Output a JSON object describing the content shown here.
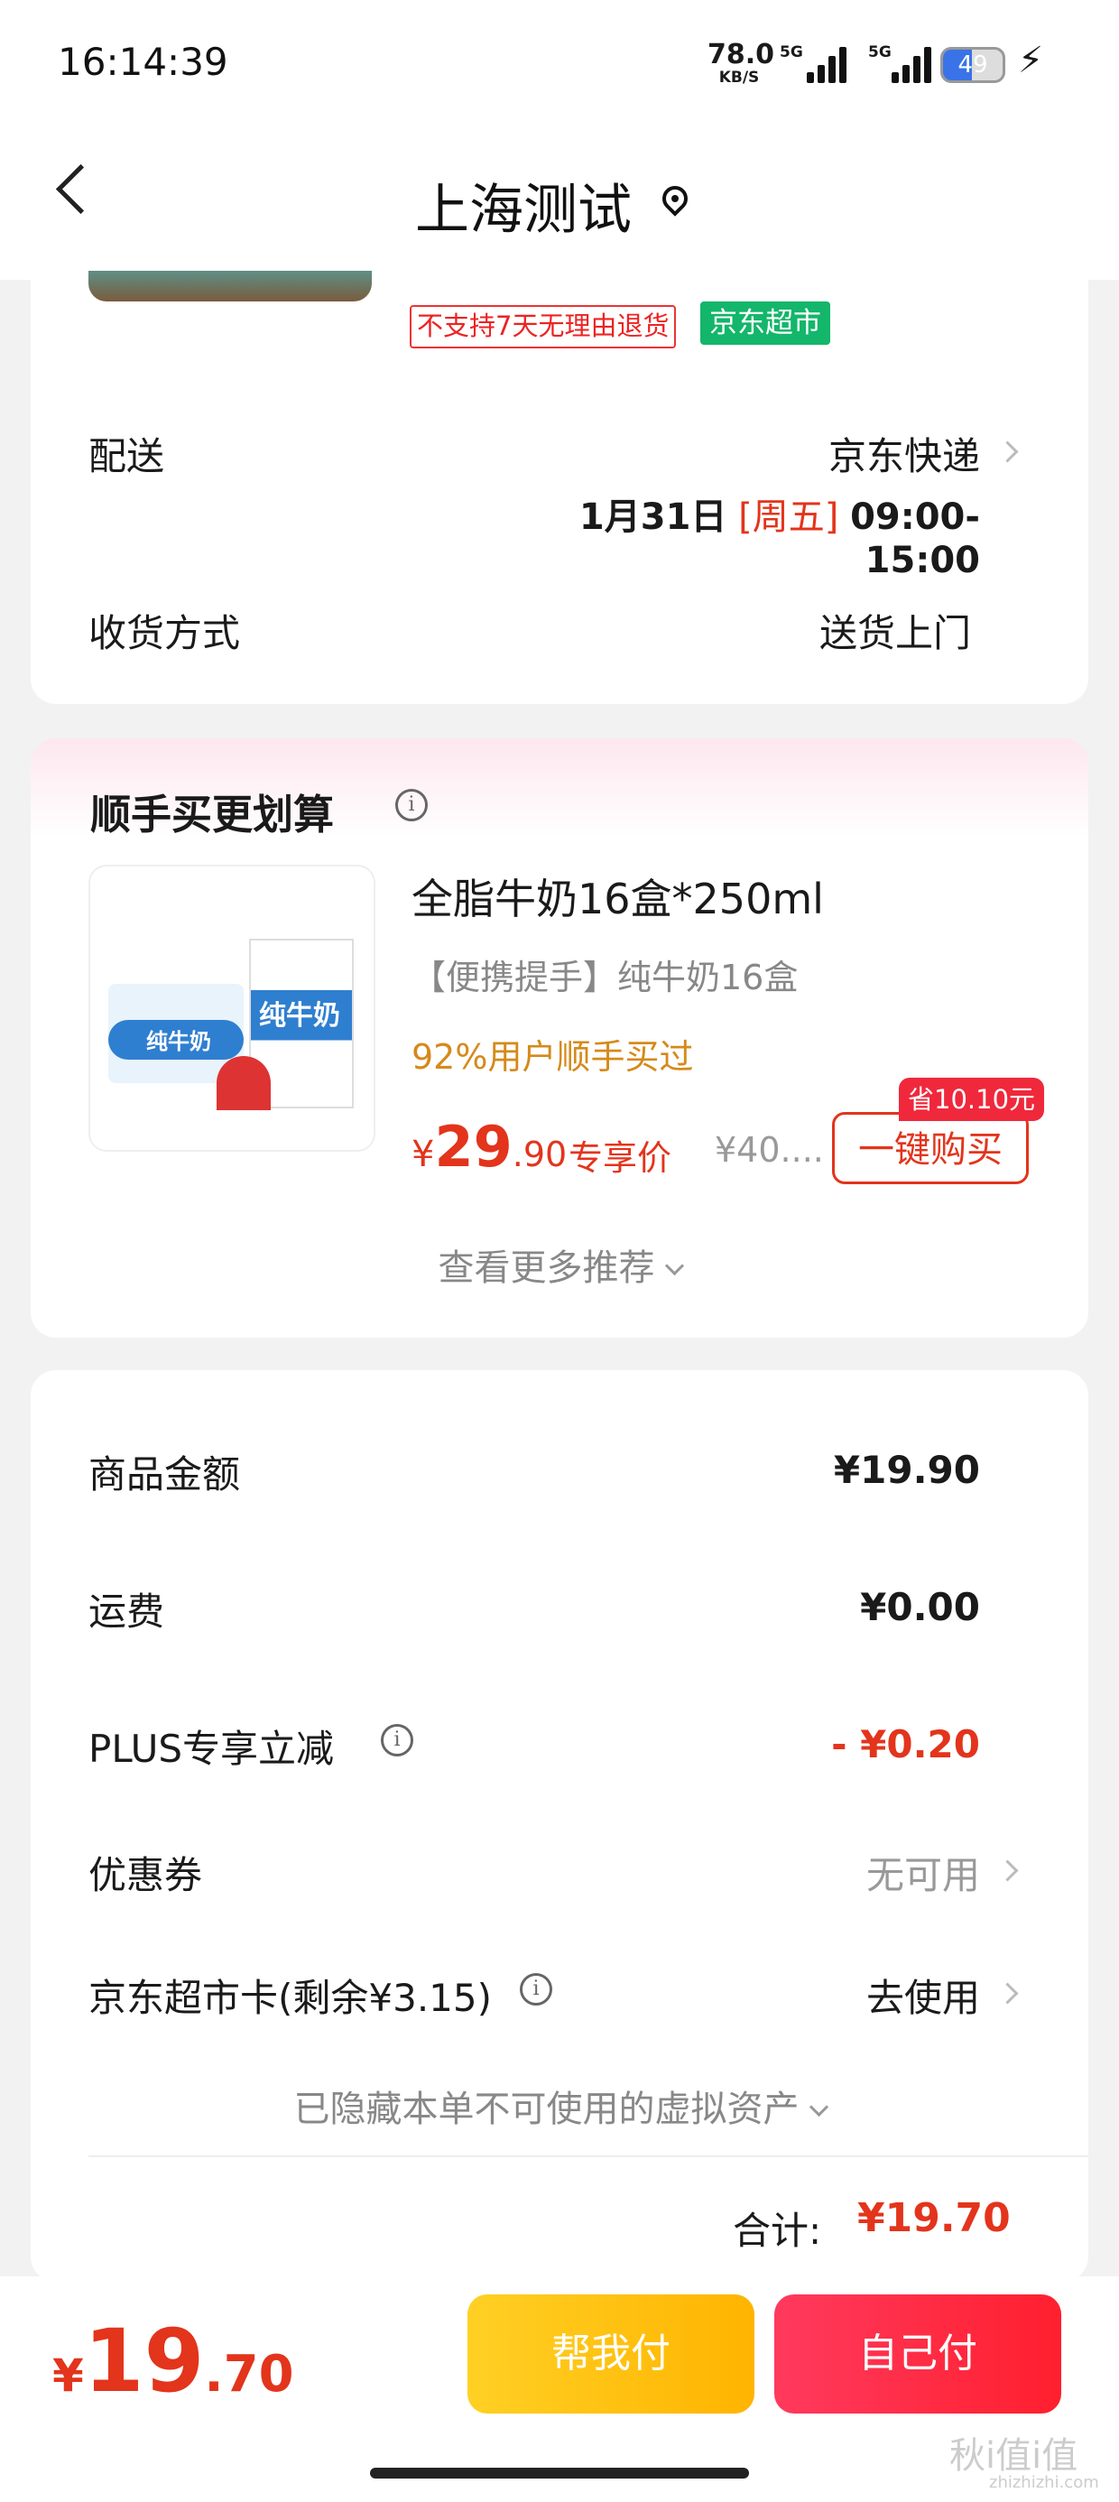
{
  "status_bar": {
    "time": "16:14:39",
    "net_speed": "78.0",
    "net_unit": "KB/S",
    "signal_1": "5G",
    "signal_2": "5G",
    "battery": "49"
  },
  "nav": {
    "title": "上海测试",
    "icons": [
      "back-icon",
      "location-icon"
    ]
  },
  "product_badges": {
    "return_policy": "不支持7天无理由退货",
    "store": "京东超市"
  },
  "delivery": {
    "label": "配送",
    "carrier": "京东快递",
    "date": "1月31日",
    "weekday": "[周五]",
    "time_window": "09:00-15:00"
  },
  "receive": {
    "label": "收货方式",
    "value": "送货上门"
  },
  "recommend": {
    "title": "顺手买更划算",
    "product": {
      "name": "全脂牛奶16盒*250ml",
      "desc": "【便携提手】纯牛奶16盒",
      "social": "92%用户顺手买过",
      "price_symbol": "¥",
      "price_int": "29",
      "price_dec": ".90",
      "price_label": "专享价",
      "original_price": "¥40....",
      "save_tag": "省10.10元",
      "buy_label": "一键购买",
      "image_text": "纯牛奶"
    },
    "more_label": "查看更多推荐"
  },
  "summary": {
    "items_label": "商品金额",
    "items_value": "¥19.90",
    "shipping_label": "运费",
    "shipping_value": "¥0.00",
    "plus_label": "PLUS专享立减",
    "plus_value": "- ¥0.20",
    "coupon_label": "优惠券",
    "coupon_value": "无可用",
    "card_label": "京东超市卡(剩余¥3.15)",
    "card_value": "去使用",
    "hidden_assets": "已隐藏本单不可使用的虚拟资产",
    "total_label": "合计:",
    "total_value": "¥19.70"
  },
  "bottom": {
    "symbol": "¥",
    "int": "19",
    "dec": ".70",
    "help_pay": "帮我付",
    "self_pay": "自己付"
  },
  "watermark": {
    "text": "秋i值i值",
    "sub": "zhizhizhi.com"
  },
  "colors": {
    "accent_red": "#e3341c",
    "help_pay_yellow": "#ffc000",
    "self_pay_red": "#ff2a44",
    "store_green": "#13b66a"
  }
}
